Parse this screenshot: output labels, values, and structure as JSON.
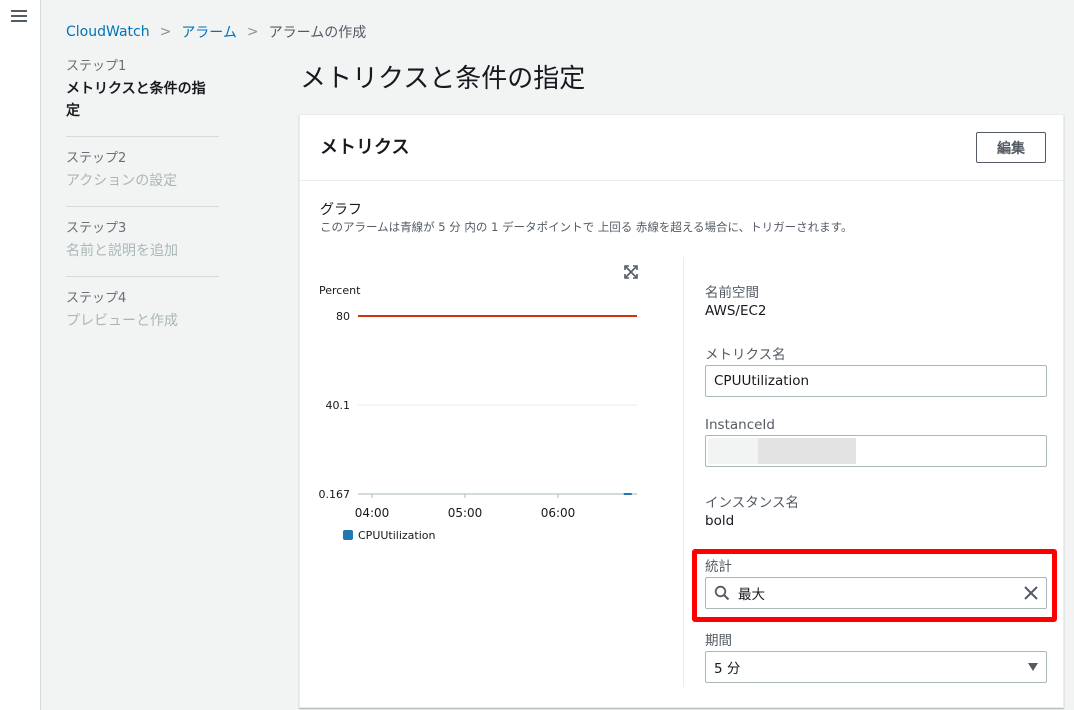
{
  "breadcrumb": {
    "root": "CloudWatch",
    "alarms": "アラーム",
    "current": "アラームの作成"
  },
  "steps": [
    {
      "num": "ステップ1",
      "title": "メトリクスと条件の指定"
    },
    {
      "num": "ステップ2",
      "title": "アクションの設定"
    },
    {
      "num": "ステップ3",
      "title": "名前と説明を追加"
    },
    {
      "num": "ステップ4",
      "title": "プレビューと作成"
    }
  ],
  "page_title": "メトリクスと条件の指定",
  "panel": {
    "title": "メトリクス",
    "edit_label": "編集",
    "graph_label": "グラフ",
    "graph_desc": "このアラームは青線が 5 分 内の 1 データポイントで 上回る 赤線を超える場合に、トリガーされます。"
  },
  "chart_data": {
    "type": "line",
    "ylabel": "Percent",
    "y_ticks": [
      "80",
      "40.1",
      "0.167"
    ],
    "x_ticks": [
      "04:00",
      "05:00",
      "06:00"
    ],
    "threshold": 80,
    "ylim": [
      0.167,
      80
    ],
    "series": [
      {
        "name": "CPUUtilization",
        "color": "#1f77b4",
        "x": [
          "06:45"
        ],
        "y": [
          0.167
        ]
      }
    ],
    "threshold_color": "#d13212"
  },
  "fields": {
    "namespace_label": "名前空間",
    "namespace_value": "AWS/EC2",
    "metric_name_label": "メトリクス名",
    "metric_name_value": "CPUUtilization",
    "instance_id_label": "InstanceId",
    "instance_name_label": "インスタンス名",
    "instance_name_value": "bold",
    "statistic_label": "統計",
    "statistic_value": "最大",
    "period_label": "期間",
    "period_value": "5 分"
  },
  "colors": {
    "link": "#0073bb",
    "highlight": "#ff0000",
    "threshold": "#d13212",
    "series": "#1f77b4"
  }
}
